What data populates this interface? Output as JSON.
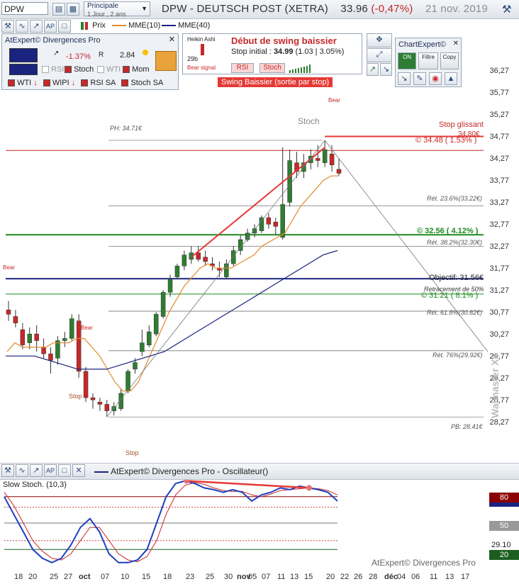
{
  "toolbar": {
    "symbol": "DPW",
    "timeframe_top": "Principale",
    "timeframe_bottom": "1 Jour , 2 ans",
    "title_name": "DPW - DEUTSCH POST (XETRA)",
    "title_price": "33.96",
    "title_change": "(-0,47%)",
    "title_date": "21 nov. 2019"
  },
  "legend": {
    "prix": "Prix",
    "mme10": "MME(10)",
    "mme40": "MME(40)"
  },
  "divergences_panel": {
    "title": "AtExpert© Divergences Pro",
    "pct": "-1.37%",
    "val": "2.84",
    "rsi": "RSI",
    "stoch": "Stoch",
    "wti": "WTI",
    "mom": "Mom",
    "row3": [
      "WTI",
      "WIPI",
      "RSI SA",
      "Stoch SA"
    ]
  },
  "swing_panel": {
    "heikin": "Heikin Ashi",
    "bear_signal": "Bear signal",
    "days": "29b",
    "title": "Début de swing baissier",
    "stop_label": "Stop initial :",
    "stop_value": "34.99",
    "stop_detail": "(1.03 | 3.05%)",
    "rsi_btn": "RSI",
    "stoch_btn": "Stoch",
    "banner": "Swing Baissier (sortie par stop)"
  },
  "chartexpert": {
    "title": "ChartExpert©",
    "on": "ON",
    "filtre": "Filtre",
    "copy": "Copy"
  },
  "annotations": {
    "ph": "PH: 34.71€",
    "pb": "PB: 28.41€",
    "stoch": "Stoch",
    "stop_glissant": "Stop glissant",
    "stop_glissant_val": "34.80€",
    "resistance": "© 34.48 ( 1.53% )",
    "support1": "© 32.56 ( 4.12% )",
    "support2": "© 31.21 ( 8.1% )",
    "objectif": "Objectif: 31.56€",
    "retracement": "Retracement de 50%",
    "ret236": "Rét. 23.6%(33.22€)",
    "ret382": "Rét. 38.2%(32.30€)",
    "ret618": "Rét. 61.8%(30.82€)",
    "ret76": "Rét. 76%(29.92€)",
    "bear": "Bear",
    "stop": "Stop",
    "watermark": "Walmaster Xe"
  },
  "oscillator": {
    "title": "AtExpert© Divergences Pro - Oscillateur()",
    "slow_stoch": "Slow Stoch. (10,3)",
    "badge80": "80",
    "badge50": "50",
    "badge20": "20",
    "level2910": "29.10",
    "footer": "AtExpert© Divergences Pro"
  },
  "x_labels": [
    "18",
    "20",
    "25",
    "27",
    "oct",
    "07",
    "10",
    "15",
    "18",
    "23",
    "25",
    "30",
    "nov",
    "05",
    "07",
    "11",
    "13",
    "15",
    "20",
    "22",
    "26",
    "28",
    "déc",
    "04",
    "06",
    "11",
    "13",
    "17"
  ],
  "chart_data": {
    "type": "candlestick",
    "title": "DPW - DEUTSCH POST (XETRA)",
    "ylim": [
      27.9,
      36.55
    ],
    "y_ticks": [
      36.27,
      35.77,
      35.27,
      34.77,
      34.27,
      33.77,
      33.27,
      32.77,
      32.27,
      31.77,
      31.27,
      30.77,
      30.27,
      29.77,
      29.27,
      28.77,
      28.27
    ],
    "candles": [
      {
        "o": 30.85,
        "h": 31.05,
        "l": 30.6,
        "c": 30.75
      },
      {
        "o": 30.7,
        "h": 30.85,
        "l": 30.45,
        "c": 30.55
      },
      {
        "o": 30.4,
        "h": 30.55,
        "l": 29.95,
        "c": 30.05
      },
      {
        "o": 30.1,
        "h": 30.45,
        "l": 29.95,
        "c": 30.3
      },
      {
        "o": 30.3,
        "h": 30.5,
        "l": 29.9,
        "c": 30.15
      },
      {
        "o": 30.0,
        "h": 30.2,
        "l": 29.75,
        "c": 29.85
      },
      {
        "o": 29.85,
        "h": 30.0,
        "l": 29.4,
        "c": 29.7
      },
      {
        "o": 29.75,
        "h": 30.25,
        "l": 29.6,
        "c": 30.15
      },
      {
        "o": 30.15,
        "h": 30.35,
        "l": 30.0,
        "c": 30.2
      },
      {
        "o": 30.2,
        "h": 30.75,
        "l": 30.15,
        "c": 30.65
      },
      {
        "o": 30.6,
        "h": 30.75,
        "l": 29.3,
        "c": 29.45
      },
      {
        "o": 29.45,
        "h": 29.55,
        "l": 28.75,
        "c": 28.85
      },
      {
        "o": 28.85,
        "h": 28.95,
        "l": 28.6,
        "c": 28.8
      },
      {
        "o": 28.75,
        "h": 28.85,
        "l": 28.55,
        "c": 28.7
      },
      {
        "o": 28.7,
        "h": 28.8,
        "l": 28.41,
        "c": 28.55
      },
      {
        "o": 28.55,
        "h": 28.75,
        "l": 28.45,
        "c": 28.65
      },
      {
        "o": 28.6,
        "h": 29.05,
        "l": 28.55,
        "c": 28.95
      },
      {
        "o": 29.0,
        "h": 29.5,
        "l": 28.95,
        "c": 29.45
      },
      {
        "o": 29.5,
        "h": 29.75,
        "l": 29.4,
        "c": 29.65
      },
      {
        "o": 29.9,
        "h": 30.4,
        "l": 29.8,
        "c": 30.1
      },
      {
        "o": 30.05,
        "h": 30.5,
        "l": 30.0,
        "c": 30.35
      },
      {
        "o": 30.3,
        "h": 30.8,
        "l": 30.25,
        "c": 30.75
      },
      {
        "o": 30.7,
        "h": 31.3,
        "l": 30.65,
        "c": 31.25
      },
      {
        "o": 31.25,
        "h": 31.65,
        "l": 31.15,
        "c": 31.55
      },
      {
        "o": 31.6,
        "h": 31.9,
        "l": 31.55,
        "c": 31.85
      },
      {
        "o": 31.85,
        "h": 32.2,
        "l": 31.75,
        "c": 32.1
      },
      {
        "o": 32.0,
        "h": 32.3,
        "l": 31.9,
        "c": 32.15
      },
      {
        "o": 32.15,
        "h": 32.3,
        "l": 31.95,
        "c": 32.0
      },
      {
        "o": 32.05,
        "h": 32.2,
        "l": 31.85,
        "c": 31.95
      },
      {
        "o": 31.9,
        "h": 32.05,
        "l": 31.75,
        "c": 31.85
      },
      {
        "o": 31.8,
        "h": 31.95,
        "l": 31.6,
        "c": 31.75
      },
      {
        "o": 31.6,
        "h": 32.0,
        "l": 31.55,
        "c": 31.9
      },
      {
        "o": 31.9,
        "h": 32.3,
        "l": 31.85,
        "c": 32.2
      },
      {
        "o": 32.2,
        "h": 32.55,
        "l": 32.1,
        "c": 32.45
      },
      {
        "o": 32.45,
        "h": 32.7,
        "l": 32.4,
        "c": 32.6
      },
      {
        "o": 32.6,
        "h": 32.8,
        "l": 32.5,
        "c": 32.7
      },
      {
        "o": 32.65,
        "h": 33.0,
        "l": 32.6,
        "c": 32.95
      },
      {
        "o": 32.95,
        "h": 33.05,
        "l": 32.7,
        "c": 32.8
      },
      {
        "o": 32.85,
        "h": 32.95,
        "l": 32.55,
        "c": 32.75
      },
      {
        "o": 32.5,
        "h": 34.55,
        "l": 32.45,
        "c": 33.25
      },
      {
        "o": 33.3,
        "h": 34.5,
        "l": 33.2,
        "c": 34.25
      },
      {
        "o": 34.2,
        "h": 34.45,
        "l": 33.85,
        "c": 34.0
      },
      {
        "o": 34.0,
        "h": 34.4,
        "l": 33.85,
        "c": 34.2
      },
      {
        "o": 34.2,
        "h": 34.5,
        "l": 34.05,
        "c": 34.35
      },
      {
        "o": 34.3,
        "h": 34.6,
        "l": 34.1,
        "c": 34.25
      },
      {
        "o": 34.2,
        "h": 34.71,
        "l": 34.1,
        "c": 34.5
      },
      {
        "o": 34.4,
        "h": 34.6,
        "l": 34.0,
        "c": 34.15
      },
      {
        "o": 34.05,
        "h": 34.3,
        "l": 33.9,
        "c": 33.96
      }
    ],
    "ema10_points": [
      [
        29.9,
        30.1
      ],
      [
        30.0,
        30.0
      ],
      [
        30.0,
        30.0
      ],
      [
        30.1,
        30.1
      ],
      [
        30.1,
        30.2
      ],
      [
        30.2,
        30.0
      ],
      [
        29.8,
        29.5
      ],
      [
        29.2,
        29.0
      ],
      [
        29.0,
        29.2
      ],
      [
        29.6,
        30.0
      ],
      [
        30.4,
        30.8
      ],
      [
        31.1,
        31.4
      ],
      [
        31.6,
        31.8
      ],
      [
        31.9,
        31.8
      ],
      [
        31.8,
        31.8
      ],
      [
        31.9,
        32.0
      ],
      [
        32.1,
        32.3
      ],
      [
        32.4,
        32.5
      ],
      [
        32.6,
        32.9
      ],
      [
        33.2,
        33.4
      ],
      [
        33.6,
        33.8
      ],
      [
        33.9,
        33.9
      ]
    ],
    "ema40_points": [
      [
        29.8,
        29.8
      ],
      [
        29.8,
        29.7
      ],
      [
        29.6,
        29.5
      ],
      [
        29.5,
        29.5
      ],
      [
        29.6,
        29.7
      ],
      [
        29.8,
        29.9
      ],
      [
        30.1,
        30.3
      ],
      [
        30.5,
        30.7
      ],
      [
        30.9,
        31.1
      ],
      [
        31.3,
        31.5
      ],
      [
        31.7,
        31.9
      ],
      [
        32.1,
        32.2
      ]
    ],
    "levels": {
      "ph": 34.71,
      "pb": 28.41,
      "stop_glissant": 34.8,
      "resistance": 34.48,
      "support1": 32.56,
      "support2": 31.21,
      "objectif": 31.56,
      "fib_236": 33.22,
      "fib_382": 32.3,
      "fib_618": 30.82,
      "fib_76": 29.92
    },
    "oscillator": {
      "name": "Slow Stoch. (10,3)",
      "ylim": [
        0,
        100
      ],
      "levels": [
        80,
        50,
        20
      ],
      "k": [
        80,
        60,
        40,
        20,
        10,
        5,
        10,
        25,
        45,
        55,
        40,
        15,
        5,
        5,
        8,
        20,
        50,
        80,
        95,
        98,
        95,
        90,
        88,
        85,
        88,
        85,
        75,
        82,
        85,
        90,
        88,
        92,
        90,
        88,
        85,
        75
      ],
      "d": [
        85,
        70,
        50,
        30,
        18,
        10,
        8,
        15,
        30,
        45,
        45,
        30,
        15,
        8,
        6,
        12,
        30,
        60,
        82,
        93,
        96,
        94,
        90,
        87,
        86,
        86,
        82,
        80,
        83,
        87,
        88,
        89,
        90,
        89,
        87,
        82
      ]
    }
  }
}
